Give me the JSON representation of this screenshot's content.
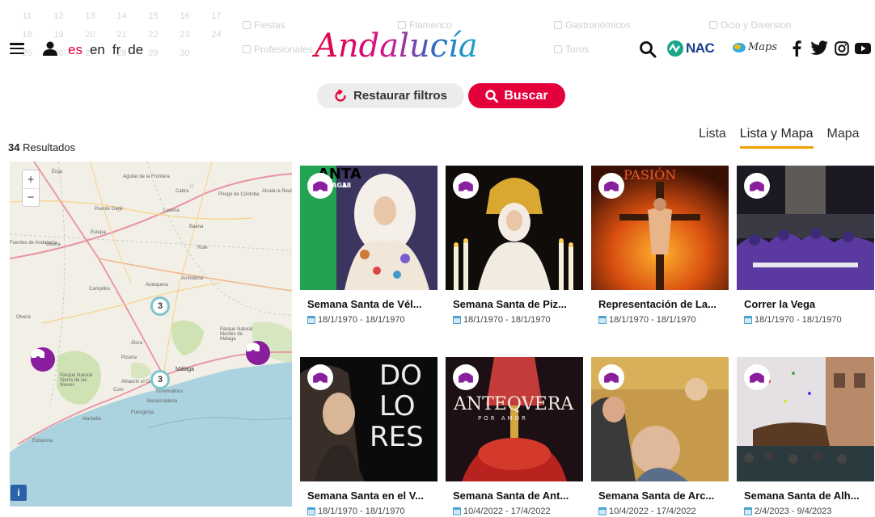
{
  "header": {
    "languages": [
      {
        "code": "es",
        "active": true
      },
      {
        "code": "en",
        "active": false
      },
      {
        "code": "fr",
        "active": false
      },
      {
        "code": "de",
        "active": false
      }
    ],
    "logo_text": "Andalucía",
    "nac_text": "NAC",
    "maps_text": "Maps"
  },
  "ghost": {
    "calendar": [
      "11",
      "12",
      "13",
      "14",
      "15",
      "16",
      "17",
      "18",
      "19",
      "20",
      "21",
      "22",
      "23",
      "24",
      "25",
      "26",
      "27",
      "28",
      "29",
      "30"
    ],
    "filters": [
      "Fiestas",
      "Profesionales",
      "Flamenco",
      "Gastronómicos",
      "Toros",
      "Ocio y Diversion"
    ]
  },
  "buttons": {
    "reset_label": "Restaurar filtros",
    "search_label": "Buscar"
  },
  "results": {
    "count": "34",
    "label": "Resultados"
  },
  "view_tabs": [
    {
      "label": "Lista",
      "active": false
    },
    {
      "label": "Lista y Mapa",
      "active": true
    },
    {
      "label": "Mapa",
      "active": false
    }
  ],
  "map": {
    "clusters": [
      "3",
      "3"
    ],
    "zoom_in": "+",
    "zoom_out": "−",
    "info": "i",
    "labels": [
      "Écija",
      "Aguilar de la Frontera",
      "Cabra",
      "Priego de Córdoba",
      "Alcalá la Real",
      "Puente Genil",
      "Lucena",
      "Baena",
      "Estepa",
      "Rute",
      "Osuna",
      "Fuentes de Andalucía",
      "Campillos",
      "Antequera",
      "Archidona",
      "Olvera",
      "Álora",
      "Pizarra",
      "Coín",
      "Málaga",
      "Marbella",
      "Fuengirola",
      "Estepona",
      "Torremolinos",
      "Alhaurín el Grande",
      "Benalmádena",
      "Parque Natural Sierra de las Nieves",
      "Parque Natural Montes de Málaga"
    ]
  },
  "colors": {
    "brand_red": "#e4003a",
    "accent_orange": "#f0a000",
    "purple_pin": "#8a1f9e",
    "cluster_ring": "#7ec4cf"
  },
  "cards": [
    {
      "title": "Semana Santa de Vél...",
      "date": "18/1/1970 - 18/1/1970",
      "overlay": [
        "ANTA",
        "MÁLAGA",
        "18"
      ]
    },
    {
      "title": "Semana Santa de Piz...",
      "date": "18/1/1970 - 18/1/1970",
      "overlay": []
    },
    {
      "title": "Representación de La...",
      "date": "18/1/1970 - 18/1/1970",
      "overlay": [
        "PASIÓN"
      ]
    },
    {
      "title": "Correr la Vega",
      "date": "18/1/1970 - 18/1/1970",
      "overlay": []
    },
    {
      "title": "Semana Santa en el V...",
      "date": "18/1/1970 - 18/1/1970",
      "overlay": [
        "DO",
        "LO",
        "RES"
      ]
    },
    {
      "title": "Semana Santa de Ant...",
      "date": "10/4/2022 - 17/4/2022",
      "overlay": [
        "ANTEQVERA",
        "POR AMOR"
      ]
    },
    {
      "title": "Semana Santa de Arc...",
      "date": "10/4/2022 - 17/4/2022",
      "overlay": []
    },
    {
      "title": "Semana Santa de Alh...",
      "date": "2/4/2023 - 9/4/2023",
      "overlay": []
    }
  ]
}
